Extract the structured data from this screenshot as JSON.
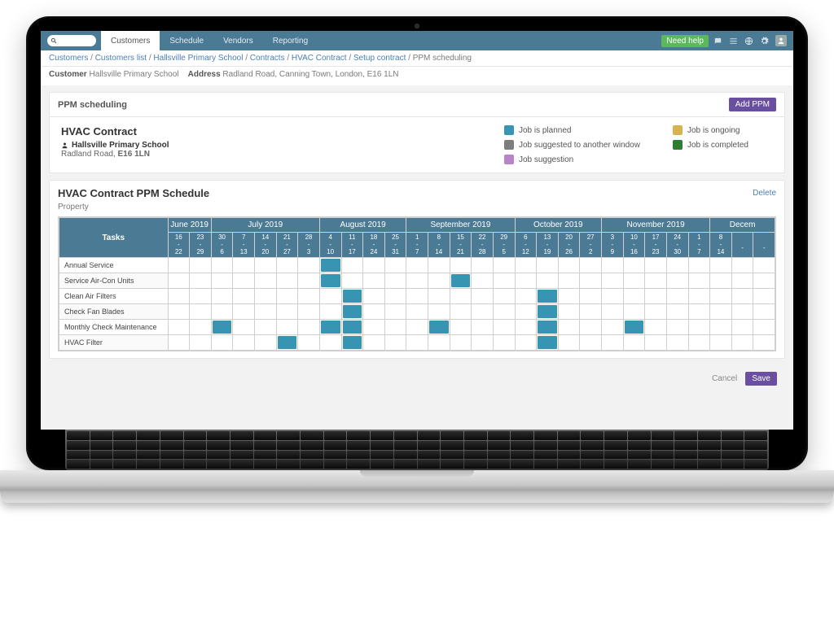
{
  "topbar": {
    "tabs": [
      "Customers",
      "Schedule",
      "Vendors",
      "Reporting"
    ],
    "active_tab": 0,
    "help_label": "Need help"
  },
  "breadcrumb": {
    "links": [
      "Customers",
      "Customers list",
      "Hallsville Primary School",
      "Contracts",
      "HVAC Contract",
      "Setup contract"
    ],
    "current": "PPM scheduling"
  },
  "meta": {
    "customer_label": "Customer",
    "customer": "Hallsville Primary School",
    "address_label": "Address",
    "address": "Radland Road, Canning Town, London, E16 1LN"
  },
  "ppm_card": {
    "title": "PPM scheduling",
    "add_btn": "Add PPM",
    "contract_title": "HVAC Contract",
    "customer": "Hallsville Primary School",
    "addr_line1": "Radland Road,",
    "addr_post": "E16 1LN"
  },
  "legend": {
    "planned": "Job is planned",
    "ongoing": "Job is ongoing",
    "suggested_other": "Job suggested to another window",
    "completed": "Job is completed",
    "suggestion": "Job suggestion"
  },
  "colors": {
    "planned": "#3894b3",
    "ongoing": "#d4b452",
    "suggested_other": "#7d7d7d",
    "completed": "#2e7d32",
    "suggestion": "#b783c9"
  },
  "schedule": {
    "title": "HVAC Contract PPM Schedule",
    "delete": "Delete",
    "property_label": "Property",
    "tasks_header": "Tasks",
    "months": [
      "June 2019",
      "July 2019",
      "August 2019",
      "September 2019",
      "October 2019",
      "November 2019",
      "Decem"
    ],
    "month_spans": [
      2,
      5,
      4,
      5,
      4,
      5,
      3
    ],
    "weeks": [
      {
        "t": "16",
        "b": "22"
      },
      {
        "t": "23",
        "b": "29"
      },
      {
        "t": "30",
        "b": "6"
      },
      {
        "t": "7",
        "b": "13"
      },
      {
        "t": "14",
        "b": "20"
      },
      {
        "t": "21",
        "b": "27"
      },
      {
        "t": "28",
        "b": "3"
      },
      {
        "t": "4",
        "b": "10"
      },
      {
        "t": "11",
        "b": "17"
      },
      {
        "t": "18",
        "b": "24"
      },
      {
        "t": "25",
        "b": "31"
      },
      {
        "t": "1",
        "b": "7"
      },
      {
        "t": "8",
        "b": "14"
      },
      {
        "t": "15",
        "b": "21"
      },
      {
        "t": "22",
        "b": "28"
      },
      {
        "t": "29",
        "b": "5"
      },
      {
        "t": "6",
        "b": "12"
      },
      {
        "t": "13",
        "b": "19"
      },
      {
        "t": "20",
        "b": "26"
      },
      {
        "t": "27",
        "b": "2"
      },
      {
        "t": "3",
        "b": "9"
      },
      {
        "t": "10",
        "b": "16"
      },
      {
        "t": "17",
        "b": "23"
      },
      {
        "t": "24",
        "b": "30"
      },
      {
        "t": "1",
        "b": "7"
      },
      {
        "t": "8",
        "b": "14"
      },
      {
        "t": "",
        "b": ""
      },
      {
        "t": "",
        "b": ""
      }
    ],
    "tasks": [
      "Annual Service",
      "Service Air-Con Units",
      "Clean Air Filters",
      "Check Fan Blades",
      "Monthly Check Maintenance",
      "HVAC Filter"
    ],
    "filled": {
      "0": [
        7
      ],
      "1": [
        7,
        13
      ],
      "2": [
        8,
        17
      ],
      "3": [
        8,
        17
      ],
      "4": [
        2,
        7,
        8,
        12,
        17,
        21
      ],
      "5": [
        5,
        8,
        17
      ]
    }
  },
  "footer": {
    "cancel": "Cancel",
    "save": "Save"
  }
}
